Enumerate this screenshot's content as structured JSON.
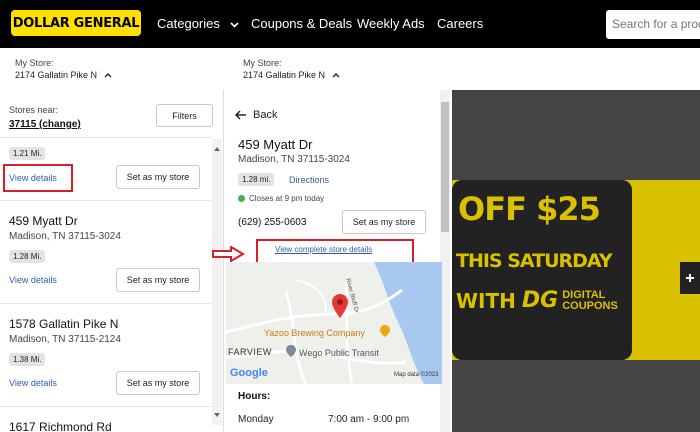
{
  "header": {
    "logo_text": "DOLLAR GENERAL",
    "nav": {
      "categories": "Categories",
      "coupons": "Coupons & Deals",
      "weekly_ads": "Weekly Ads",
      "careers": "Careers"
    },
    "search_placeholder": "Search for a product"
  },
  "store_bar": {
    "label": "My Store:",
    "value": "2174 Gallatin Pike N"
  },
  "left_panel": {
    "stores_near_label": "Stores near:",
    "zip": "37115 (change)",
    "filters_label": "Filters",
    "stores": [
      {
        "name": "",
        "address": "",
        "distance": "1.21 Mi.",
        "details_label": "View details",
        "set_label": "Set as my store"
      },
      {
        "name": "459 Myatt Dr",
        "address": "Madison, TN 37115-3024",
        "distance": "1.28 Mi.",
        "details_label": "View details",
        "set_label": "Set as my store"
      },
      {
        "name": "1578 Gallatin Pike N",
        "address": "Madison, TN 37115-2124",
        "distance": "1.38 Mi.",
        "details_label": "View details",
        "set_label": "Set as my store"
      },
      {
        "name": "1617 Richmond Rd",
        "address": "",
        "distance": "",
        "details_label": "",
        "set_label": ""
      }
    ]
  },
  "detail_panel": {
    "back_label": "Back",
    "name": "459 Myatt Dr",
    "address": "Madison, TN 37115-3024",
    "distance": "1.28 mi.",
    "directions_label": "Directions",
    "status": "Closes at 9 pm today",
    "status_color": "#3cb54a",
    "phone": "(629) 255-0603",
    "set_label": "Set as my store",
    "view_complete_label": "View complete store details",
    "hours_label": "Hours:",
    "hours": [
      {
        "day": "Monday",
        "time": "7:00 am - 9:00 pm"
      }
    ],
    "map": {
      "street_label": "River Bluff Dr",
      "place_label": "Yazoo Brewing Company",
      "area_label": "FARVIEW",
      "transit_label": "Wego Public Transit",
      "google_label": "Google",
      "attribution": "Map data ©2023"
    }
  },
  "promo": {
    "line1": "OFF $25",
    "line2": "THIS SATURDAY",
    "line3": "WITH",
    "brand": "DG",
    "line4": "DIGITAL",
    "line5": "COUPONS"
  },
  "colors": {
    "brand_yellow": "#ffe000",
    "link_blue": "#2f5ea9",
    "annotation_red": "#d42029"
  }
}
